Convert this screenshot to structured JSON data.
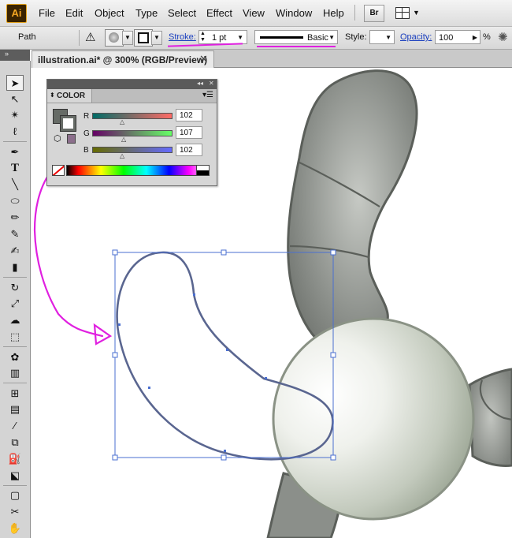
{
  "app": {
    "logo": "Ai",
    "menus": [
      "File",
      "Edit",
      "Object",
      "Type",
      "Select",
      "Effect",
      "View",
      "Window",
      "Help"
    ],
    "bridge_label": "Br"
  },
  "control_bar": {
    "selection_type": "Path",
    "stroke_label": "Stroke:",
    "stroke_value": "1 pt",
    "brush_label": "Basic",
    "style_label": "Style:",
    "opacity_label": "Opacity:",
    "opacity_value": "100",
    "opacity_unit": "%"
  },
  "document_tab": {
    "title": "illustration.ai* @ 300% (RGB/Preview)",
    "close": "✕"
  },
  "color_panel": {
    "tab_label": "COLOR",
    "channels": [
      {
        "name": "R",
        "value": "102"
      },
      {
        "name": "G",
        "value": "107"
      },
      {
        "name": "B",
        "value": "102"
      }
    ],
    "fill_color": "#666b66",
    "stroke_color": "#666b66"
  },
  "tools": [
    "selection-tool",
    "direct-selection-tool",
    "magic-wand-tool",
    "lasso-tool",
    "pen-tool",
    "type-tool",
    "line-segment-tool",
    "ellipse-tool",
    "paintbrush-tool",
    "pencil-tool",
    "blob-brush-tool",
    "eraser-tool",
    "rotate-tool",
    "scale-tool",
    "warp-tool",
    "free-transform-tool",
    "symbol-sprayer-tool",
    "column-graph-tool",
    "mesh-tool",
    "gradient-tool",
    "eyedropper-tool",
    "blend-tool",
    "live-paint-bucket-tool",
    "live-paint-selection-tool",
    "artboard-tool",
    "slice-tool",
    "hand-tool"
  ],
  "colors": {
    "annotation": "#e020e0",
    "selection": "#4a6fd0",
    "path_stroke": "#5a6690",
    "shape_fill": "#8d918c"
  }
}
